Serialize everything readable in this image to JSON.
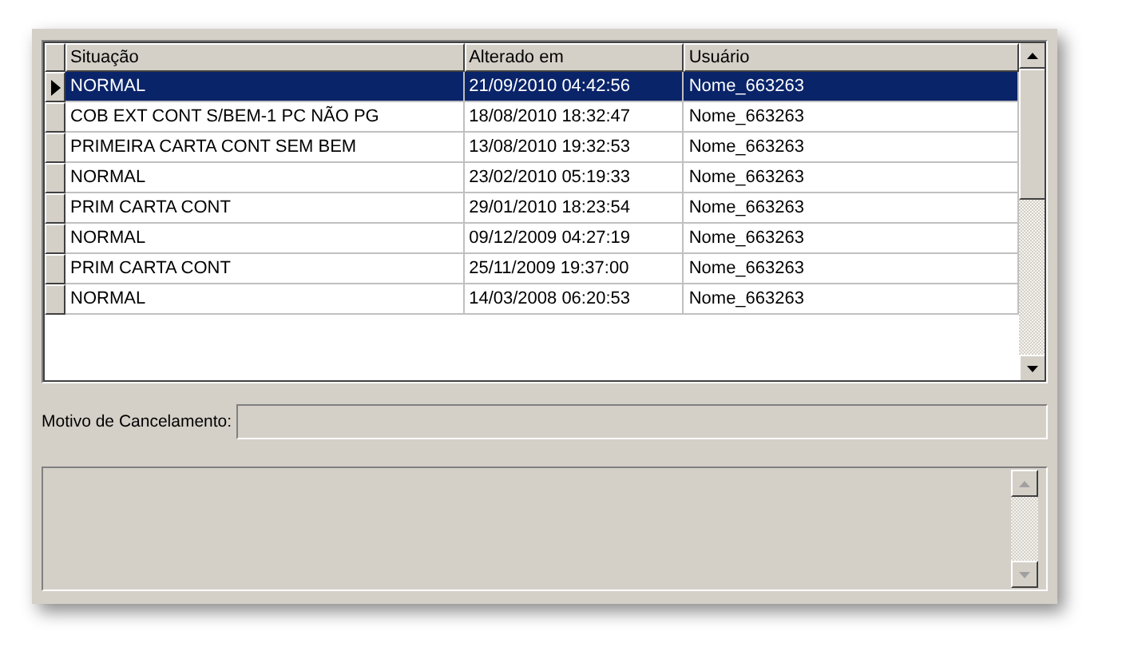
{
  "table": {
    "columns": [
      "Situação",
      "Alterado em",
      "Usuário"
    ],
    "rows": [
      {
        "cells": [
          "NORMAL",
          "21/09/2010 04:42:56",
          "Nome_663263"
        ],
        "selected": true
      },
      {
        "cells": [
          "COB EXT CONT S/BEM-1 PC NÃO PG",
          "18/08/2010 18:32:47",
          "Nome_663263"
        ],
        "selected": false
      },
      {
        "cells": [
          "PRIMEIRA CARTA CONT SEM BEM",
          "13/08/2010 19:32:53",
          "Nome_663263"
        ],
        "selected": false
      },
      {
        "cells": [
          "NORMAL",
          "23/02/2010 05:19:33",
          "Nome_663263"
        ],
        "selected": false
      },
      {
        "cells": [
          "PRIM CARTA CONT",
          "29/01/2010 18:23:54",
          "Nome_663263"
        ],
        "selected": false
      },
      {
        "cells": [
          "NORMAL",
          "09/12/2009 04:27:19",
          "Nome_663263"
        ],
        "selected": false
      },
      {
        "cells": [
          "PRIM CARTA CONT",
          "25/11/2009 19:37:00",
          "Nome_663263"
        ],
        "selected": false
      },
      {
        "cells": [
          "NORMAL",
          "14/03/2008 06:20:53",
          "Nome_663263"
        ],
        "selected": false
      }
    ]
  },
  "cancel_reason": {
    "label": "Motivo de Cancelamento:"
  }
}
